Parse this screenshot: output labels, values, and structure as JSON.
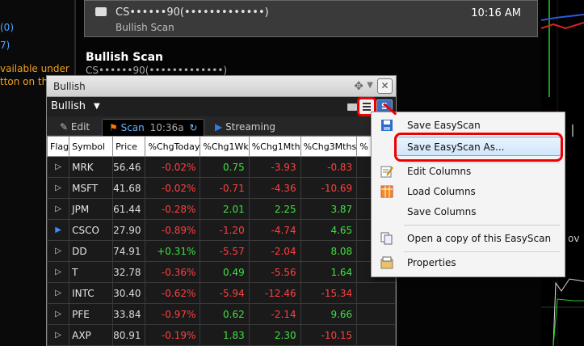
{
  "left_panel": {
    "lines": [
      {
        "text": "(0)",
        "color": "blue"
      },
      {
        "text": "7)",
        "color": "blue"
      },
      {
        "text": "vailable under",
        "color": "orange"
      },
      {
        "text": "tton on th",
        "color": "orange"
      }
    ]
  },
  "message": {
    "sender": "CS••••••90(•••••••••••••)",
    "subject": "Bullish Scan",
    "time": "10:16 AM"
  },
  "section": {
    "title": "Bullish Scan",
    "subtitle": "CS••••••90(•••••••••••••)"
  },
  "window": {
    "title": "Bullish",
    "scan_name": "Bullish",
    "s_button": "S",
    "tabs": {
      "edit": "Edit",
      "scan": "Scan",
      "scan_time": "10:36a",
      "streaming": "Streaming"
    },
    "columns": [
      "Flag",
      "Symbol",
      "Price",
      "%ChgToday",
      "%Chg1Wk",
      "%Chg1Mth",
      "%Chg3Mths",
      "%"
    ],
    "rows": [
      {
        "flag": "▷",
        "symbol": "MRK",
        "price": "56.46",
        "today": "-0.02%",
        "wk": "0.75",
        "mth": "-3.93",
        "m3": "-0.83"
      },
      {
        "flag": "▷",
        "symbol": "MSFT",
        "price": "41.68",
        "today": "-0.02%",
        "wk": "-0.71",
        "mth": "-4.36",
        "m3": "-10.69"
      },
      {
        "flag": "▷",
        "symbol": "JPM",
        "price": "61.44",
        "today": "-0.28%",
        "wk": "2.01",
        "mth": "2.25",
        "m3": "3.87"
      },
      {
        "flag": "▶",
        "symbol": "CSCO",
        "price": "27.90",
        "today": "-0.89%",
        "wk": "-1.20",
        "mth": "-4.74",
        "m3": "4.65"
      },
      {
        "flag": "▷",
        "symbol": "DD",
        "price": "74.91",
        "today": "+0.31%",
        "wk": "-5.57",
        "mth": "-2.04",
        "m3": "8.08"
      },
      {
        "flag": "▷",
        "symbol": "T",
        "price": "32.78",
        "today": "-0.36%",
        "wk": "0.49",
        "mth": "-5.56",
        "m3": "1.64"
      },
      {
        "flag": "▷",
        "symbol": "INTC",
        "price": "30.40",
        "today": "-0.62%",
        "wk": "-5.94",
        "mth": "-12.46",
        "m3": "-15.34"
      },
      {
        "flag": "▷",
        "symbol": "PFE",
        "price": "33.84",
        "today": "-0.97%",
        "wk": "0.62",
        "mth": "-2.14",
        "m3": "9.66"
      },
      {
        "flag": "▷",
        "symbol": "AXP",
        "price": "80.91",
        "today": "-0.19%",
        "wk": "1.83",
        "mth": "2.30",
        "m3": "-10.15"
      }
    ]
  },
  "context_menu": {
    "items": [
      {
        "label": "Save EasyScan",
        "icon": "save-icon"
      },
      {
        "label": "Save EasyScan As...",
        "icon": "",
        "selected": true
      },
      {
        "label": "Edit Columns",
        "icon": "edit-columns-icon"
      },
      {
        "label": "Load Columns",
        "icon": "load-columns-icon"
      },
      {
        "label": "Save Columns",
        "icon": ""
      },
      {
        "label": "Open a copy of this EasyScan",
        "icon": "copy-icon"
      },
      {
        "label": "Properties",
        "icon": "properties-icon"
      }
    ]
  },
  "right_chart": {
    "label": "ov",
    "big_glyph": "I"
  },
  "colors": {
    "negative": "#ff4040",
    "positive": "#40e040",
    "highlight": "#e00000",
    "accent": "#2c7be5"
  }
}
